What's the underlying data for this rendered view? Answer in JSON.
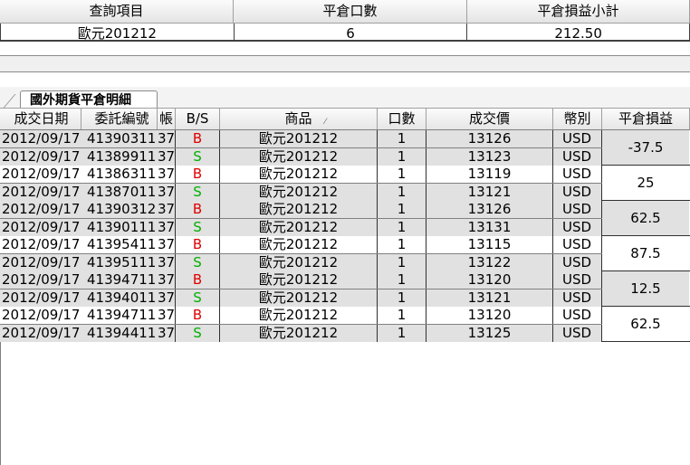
{
  "summary": {
    "headers": [
      "查詢項目",
      "平倉口數",
      "平倉損益小計"
    ],
    "row": {
      "item": "歐元201212",
      "quantity": "6",
      "pnl_subtotal": "212.50"
    }
  },
  "tab": {
    "label": "國外期貨平倉明細"
  },
  "detail": {
    "headers": [
      "成交日期",
      "委託編號",
      "帳",
      "B/S",
      "商品",
      "口數",
      "成交價",
      "幣別",
      "平倉損益"
    ],
    "sort_icon": "sort-indicator-icon",
    "pairs": [
      {
        "pnl": "-37.5",
        "shade": true,
        "rows": [
          {
            "date": "2012/09/17",
            "order": "41390311",
            "acct": "37:",
            "bs": "B",
            "product": "歐元201212",
            "qty": "1",
            "price": "13126",
            "currency": "USD"
          },
          {
            "date": "2012/09/17",
            "order": "41389911",
            "acct": "37:",
            "bs": "S",
            "product": "歐元201212",
            "qty": "1",
            "price": "13123",
            "currency": "USD"
          }
        ]
      },
      {
        "pnl": "25",
        "shade": false,
        "rows": [
          {
            "date": "2012/09/17",
            "order": "41386311",
            "acct": "37:",
            "bs": "B",
            "product": "歐元201212",
            "qty": "1",
            "price": "13119",
            "currency": "USD"
          },
          {
            "date": "2012/09/17",
            "order": "41387011",
            "acct": "37:",
            "bs": "S",
            "product": "歐元201212",
            "qty": "1",
            "price": "13121",
            "currency": "USD"
          }
        ]
      },
      {
        "pnl": "62.5",
        "shade": true,
        "rows": [
          {
            "date": "2012/09/17",
            "order": "41390312",
            "acct": "37:",
            "bs": "B",
            "product": "歐元201212",
            "qty": "1",
            "price": "13126",
            "currency": "USD"
          },
          {
            "date": "2012/09/17",
            "order": "41390111",
            "acct": "37:",
            "bs": "S",
            "product": "歐元201212",
            "qty": "1",
            "price": "13131",
            "currency": "USD"
          }
        ]
      },
      {
        "pnl": "87.5",
        "shade": false,
        "rows": [
          {
            "date": "2012/09/17",
            "order": "41395411",
            "acct": "37:",
            "bs": "B",
            "product": "歐元201212",
            "qty": "1",
            "price": "13115",
            "currency": "USD"
          },
          {
            "date": "2012/09/17",
            "order": "41395111",
            "acct": "37:",
            "bs": "S",
            "product": "歐元201212",
            "qty": "1",
            "price": "13122",
            "currency": "USD"
          }
        ]
      },
      {
        "pnl": "12.5",
        "shade": true,
        "rows": [
          {
            "date": "2012/09/17",
            "order": "41394711",
            "acct": "37:",
            "bs": "B",
            "product": "歐元201212",
            "qty": "1",
            "price": "13120",
            "currency": "USD"
          },
          {
            "date": "2012/09/17",
            "order": "41394011",
            "acct": "37:",
            "bs": "S",
            "product": "歐元201212",
            "qty": "1",
            "price": "13121",
            "currency": "USD"
          }
        ]
      },
      {
        "pnl": "62.5",
        "shade": false,
        "rows": [
          {
            "date": "2012/09/17",
            "order": "41394711",
            "acct": "37:",
            "bs": "B",
            "product": "歐元201212",
            "qty": "1",
            "price": "13120",
            "currency": "USD"
          },
          {
            "date": "2012/09/17",
            "order": "41394411",
            "acct": "37:",
            "bs": "S",
            "product": "歐元201212",
            "qty": "1",
            "price": "13125",
            "currency": "USD"
          }
        ]
      }
    ]
  },
  "colors": {
    "buy": "#e00000",
    "sell": "#00b000",
    "alt_row": "#e1e1e1"
  }
}
